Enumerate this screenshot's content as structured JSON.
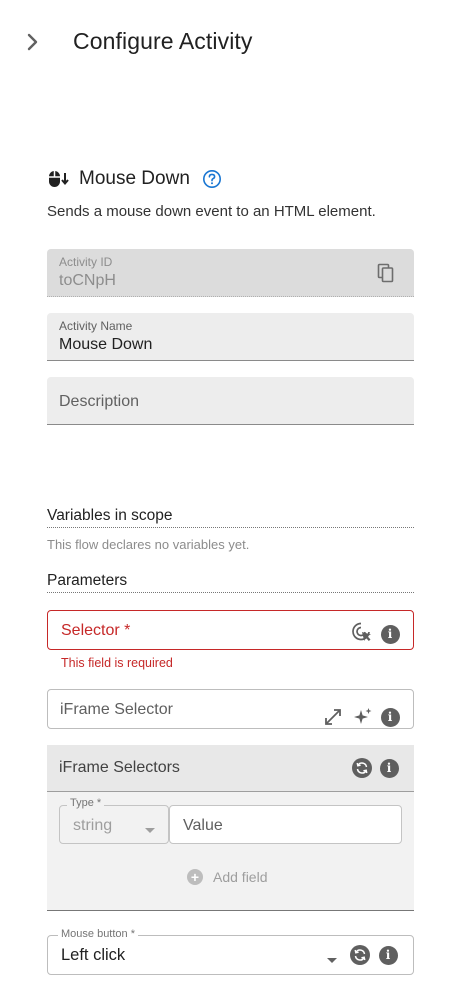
{
  "header": {
    "title": "Configure Activity",
    "collapse_icon": "chevron-right-icon"
  },
  "activity": {
    "icon": "mouse-down-icon",
    "name": "Mouse Down",
    "help_icon": "help-circle-icon",
    "description": "Sends a mouse down event to an HTML element."
  },
  "fields": {
    "activity_id": {
      "label": "Activity ID",
      "value": "toCNpH",
      "copy_icon": "copy-icon"
    },
    "activity_name": {
      "label": "Activity Name",
      "value": "Mouse Down"
    },
    "description": {
      "placeholder": "Description"
    }
  },
  "variables": {
    "title": "Variables in scope",
    "empty_text": "This flow declares no variables yet."
  },
  "parameters": {
    "title": "Parameters",
    "selector": {
      "label": "Selector *",
      "error": "This field is required",
      "icons": [
        "target-pick-icon",
        "info-icon"
      ]
    },
    "iframe_selector": {
      "placeholder": "iFrame Selector",
      "icons": [
        "expand-icon",
        "sparkle-icon",
        "info-icon"
      ]
    },
    "iframe_selectors": {
      "title": "iFrame Selectors",
      "type_label": "Type *",
      "type_value": "string",
      "value_placeholder": "Value",
      "add_label": "Add field",
      "icons": [
        "cycle-icon",
        "info-icon"
      ]
    },
    "mouse_button": {
      "label": "Mouse button *",
      "value": "Left click",
      "icons": [
        "dropdown-icon",
        "cycle-icon",
        "info-icon"
      ]
    }
  },
  "colors": {
    "error": "#c62828",
    "accent": "#1976d2",
    "field_bg": "#ededed"
  }
}
